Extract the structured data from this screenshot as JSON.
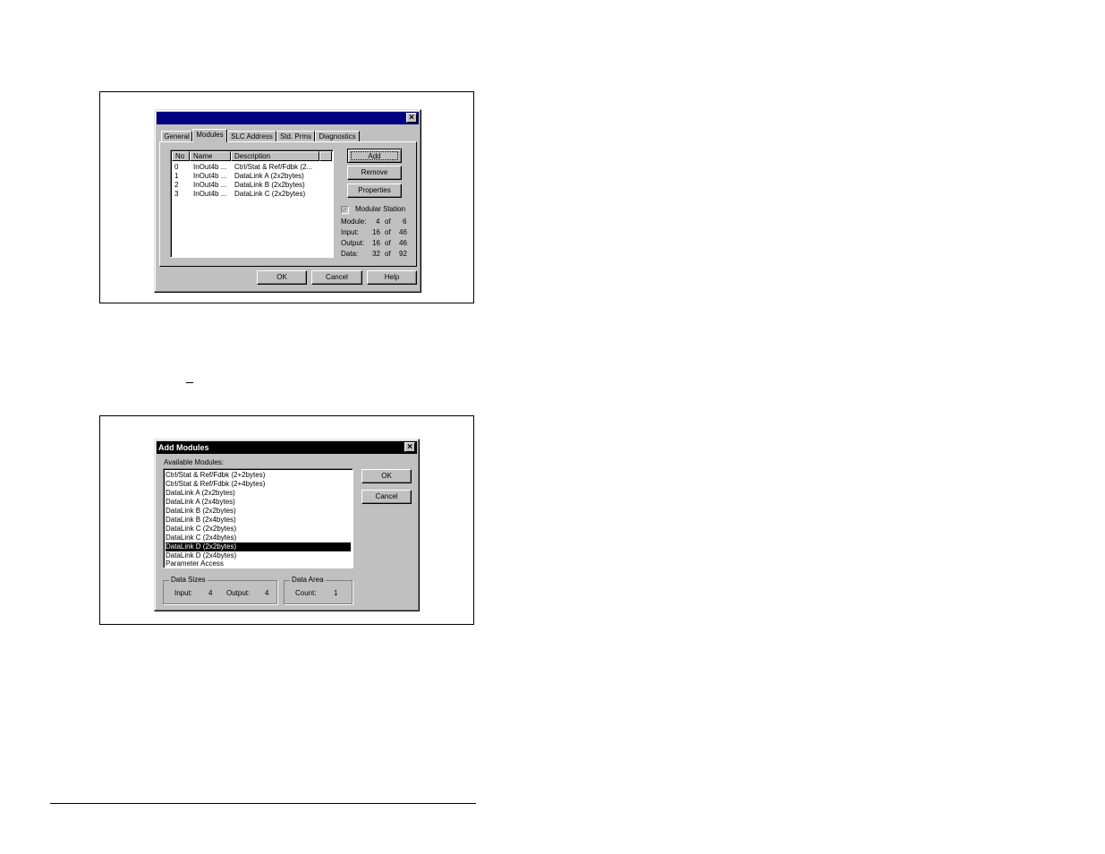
{
  "dialog1": {
    "title": "",
    "tabs": [
      "General",
      "Modules",
      "SLC Address",
      "Std. Prms",
      "Diagnostics"
    ],
    "active_tab": "Modules",
    "columns": [
      "No",
      "Name",
      "Description"
    ],
    "rows": [
      {
        "no": "0",
        "name": "InOut4b ...",
        "description": "Ctrl/Stat & Ref/Fdbk (2..."
      },
      {
        "no": "1",
        "name": "InOut4b ...",
        "description": "DataLink A (2x2bytes)"
      },
      {
        "no": "2",
        "name": "InOut4b ...",
        "description": "DataLink B (2x2bytes)"
      },
      {
        "no": "3",
        "name": "InOut4b ...",
        "description": "DataLink C (2x2bytes)"
      }
    ],
    "buttons": {
      "add": "Add",
      "remove": "Remove",
      "properties": "Properties"
    },
    "modular_station": {
      "label": "Modular Station",
      "checked": true
    },
    "stats": [
      {
        "label": "Module:",
        "value": "4",
        "of": "of",
        "max": "6"
      },
      {
        "label": "Input:",
        "value": "16",
        "of": "of",
        "max": "46"
      },
      {
        "label": "Output:",
        "value": "16",
        "of": "of",
        "max": "46"
      },
      {
        "label": "Data:",
        "value": "32",
        "of": "of",
        "max": "92"
      }
    ],
    "footer": {
      "ok": "OK",
      "cancel": "Cancel",
      "help": "Help"
    }
  },
  "dialog2": {
    "title": "Add Modules",
    "available_label": "Available Modules:",
    "modules": [
      "Ctrl/Stat & Ref/Fdbk (2+2bytes)",
      "Ctrl/Stat & Ref/Fdbk (2+4bytes)",
      "DataLink A (2x2bytes)",
      "DataLink A (2x4bytes)",
      "DataLink B (2x2bytes)",
      "DataLink B (2x4bytes)",
      "DataLink C (2x2bytes)",
      "DataLink C (2x4bytes)",
      "DataLink D (2x2bytes)",
      "DataLink D (2x4bytes)",
      "Parameter Access"
    ],
    "selected_index": 8,
    "ok": "OK",
    "cancel": "Cancel",
    "data_sizes": {
      "legend": "Data Sizes",
      "input_label": "Input:",
      "input_value": "4",
      "output_label": "Output:",
      "output_value": "4"
    },
    "data_area": {
      "legend": "Data Area",
      "count_label": "Count:",
      "count_value": "1"
    }
  },
  "colors": {
    "titlebar": "#000080",
    "face": "#c0c0c0",
    "selection": "#000000"
  }
}
